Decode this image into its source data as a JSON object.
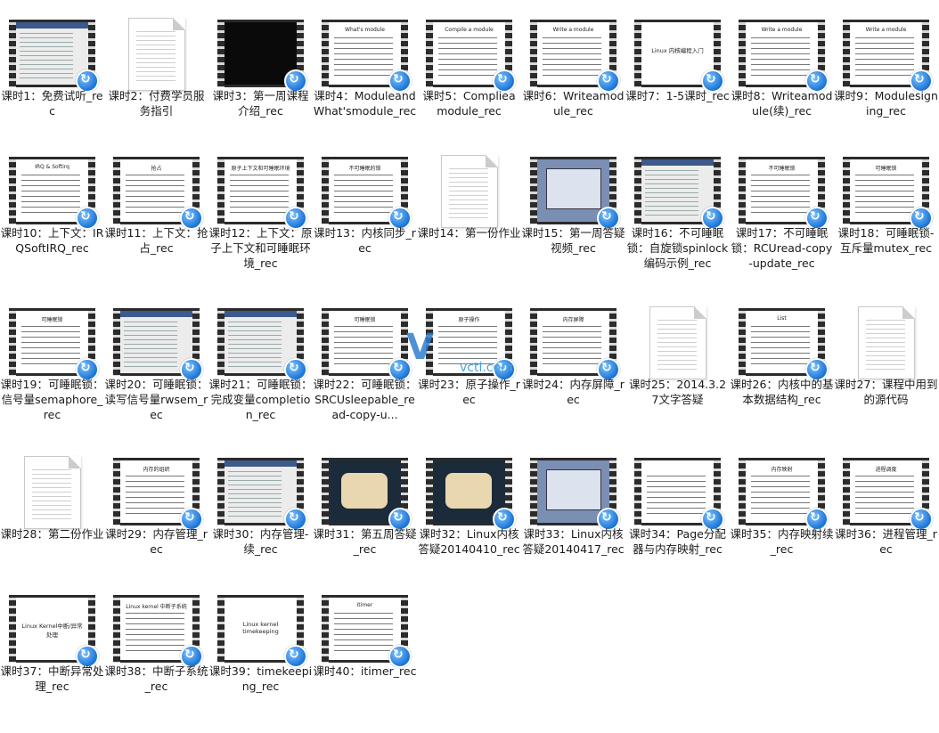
{
  "items": [
    {
      "label": "课时1：免费试听_rec",
      "thumb": "ide",
      "slide_title": ""
    },
    {
      "label": "课时2：付费学员服务指引",
      "thumb": "doc",
      "slide_title": ""
    },
    {
      "label": "课时3：第一周课程介绍_rec",
      "thumb": "dark",
      "slide_title": ""
    },
    {
      "label": "课时4：ModuleandWhat'smodule_rec",
      "thumb": "slide",
      "slide_title": "What's module"
    },
    {
      "label": "课时5：Compliea module_rec",
      "thumb": "slide",
      "slide_title": "Compile a module"
    },
    {
      "label": "课时6：Writeamodule_rec",
      "thumb": "slide",
      "slide_title": "Write a module"
    },
    {
      "label": "课时7：1-5课时_rec",
      "thumb": "plain",
      "slide_title": "Linux 内核编程入门"
    },
    {
      "label": "课时8：Writeamodule(续)_rec",
      "thumb": "slide",
      "slide_title": "Write a module"
    },
    {
      "label": "课时9：Modulesigning_rec",
      "thumb": "slide",
      "slide_title": "Write a module"
    },
    {
      "label": "课时10：上下文：IRQSoftIRQ_rec",
      "thumb": "slide",
      "slide_title": "IRQ & Softirq"
    },
    {
      "label": "课时11：上下文：抢占_rec",
      "thumb": "slide",
      "slide_title": "抢占"
    },
    {
      "label": "课时12：上下文：原子上下文和可睡眠环境_rec",
      "thumb": "slide",
      "slide_title": "原子上下文和可睡眠环境"
    },
    {
      "label": "课时13：内核同步_rec",
      "thumb": "slide",
      "slide_title": "不可睡眠的锁"
    },
    {
      "label": "课时14：第一份作业",
      "thumb": "doc",
      "slide_title": ""
    },
    {
      "label": "课时15：第一周答疑视频_rec",
      "thumb": "desk",
      "slide_title": ""
    },
    {
      "label": "课时16：不可睡眠锁：自旋锁spinlock编码示例_rec",
      "thumb": "ide",
      "slide_title": ""
    },
    {
      "label": "课时17：不可睡眠锁：RCUread-copy-update_rec",
      "thumb": "slide",
      "slide_title": "不可睡眠锁"
    },
    {
      "label": "课时18：可睡眠锁-互斥量mutex_rec",
      "thumb": "slide",
      "slide_title": "可睡眠锁"
    },
    {
      "label": "课时19：可睡眠锁：信号量semaphore_rec",
      "thumb": "slide",
      "slide_title": "可睡眠锁"
    },
    {
      "label": "课时20：可睡眠锁：读写信号量rwsem_rec",
      "thumb": "ide",
      "slide_title": ""
    },
    {
      "label": "课时21：可睡眠锁：完成变量completion_rec",
      "thumb": "ide",
      "slide_title": ""
    },
    {
      "label": "课时22：可睡眠锁：SRCUsleepable_read-copy-u...",
      "thumb": "slide",
      "slide_title": "可睡眠锁"
    },
    {
      "label": "课时23：原子操作_rec",
      "thumb": "slide",
      "slide_title": "原子操作"
    },
    {
      "label": "课时24：内存屏障_rec",
      "thumb": "slide",
      "slide_title": "内存屏障"
    },
    {
      "label": "课时25：2014.3.27文字答疑",
      "thumb": "doc",
      "slide_title": ""
    },
    {
      "label": "课时26：内核中的基本数据结构_rec",
      "thumb": "slide",
      "slide_title": "List"
    },
    {
      "label": "课时27：课程中用到的源代码",
      "thumb": "doc",
      "slide_title": ""
    },
    {
      "label": "课时28：第二份作业",
      "thumb": "doc",
      "slide_title": ""
    },
    {
      "label": "课时29：内存管理_rec",
      "thumb": "slide",
      "slide_title": "内存的组织"
    },
    {
      "label": "课时30：内存管理-续_rec",
      "thumb": "ide",
      "slide_title": ""
    },
    {
      "label": "课时31：第五周答疑_rec",
      "thumb": "cartoon",
      "slide_title": ""
    },
    {
      "label": "课时32：Linux内核答疑20140410_rec",
      "thumb": "cartoon",
      "slide_title": ""
    },
    {
      "label": "课时33：Linux内核答疑20140417_rec",
      "thumb": "desk",
      "slide_title": ""
    },
    {
      "label": "课时34：Page分配器与内存映射_rec",
      "thumb": "slide",
      "slide_title": ""
    },
    {
      "label": "课时35：内存映射续_rec",
      "thumb": "slide",
      "slide_title": "内存映射"
    },
    {
      "label": "课时36：进程管理_rec",
      "thumb": "slide",
      "slide_title": "进程调度"
    },
    {
      "label": "课时37：中断异常处理_rec",
      "thumb": "plain",
      "slide_title": "Linux Kernel中断/异常处理"
    },
    {
      "label": "课时38：中断子系统_rec",
      "thumb": "slide",
      "slide_title": "Linux kernel 中断子系统"
    },
    {
      "label": "课时39：timekeeping_rec",
      "thumb": "plain",
      "slide_title": "Linux kernel timekeeping"
    },
    {
      "label": "课时40：itimer_rec",
      "thumb": "slide",
      "slide_title": "itimer"
    }
  ],
  "watermark": {
    "mark": "V",
    "text": "vcti.com"
  }
}
